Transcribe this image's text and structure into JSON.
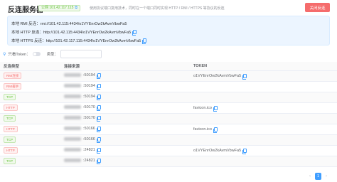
{
  "header": {
    "title": "反连服务器",
    "ip_badge": "公网 101.42.117.115",
    "description": "使用协议端口复用技术，同时在一个端口同时实现 HTTP / RMI / HTTPS 等协议的反连",
    "close_label": "关闭反连"
  },
  "info": {
    "rmi": "本地 RMI 反连：rmi://101.42.115:4434/o1VYEnrOw2kAvmVbwFa5",
    "http": "本地 HTTP 反连：http://101.42.115:4434/o1VYEnrOw2kAvmVbwFa5",
    "https": "本地 HTTPS 反连：http://101.42.117.115:4434/o1VYEnrOw2kAvmVbwFa5"
  },
  "filter": {
    "token_only_label": "只看Token：",
    "type_label": "类型："
  },
  "table": {
    "headers": [
      "反连类型",
      "连接来源",
      "TOKEN"
    ],
    "rows": [
      {
        "type": "RMI连接",
        "kind": "rmi",
        "port": ":50194",
        "token": "o1VYEnrOw2kAvmVbwFa5"
      },
      {
        "type": "RMI握手",
        "kind": "rmi",
        "port": ":50194",
        "token": ""
      },
      {
        "type": "TCP",
        "kind": "tcp",
        "port": ":50194",
        "token": ""
      },
      {
        "type": "HTTP",
        "kind": "http",
        "port": ":50170",
        "token": "favicon.ico"
      },
      {
        "type": "TCP",
        "kind": "tcp",
        "port": ":50170",
        "token": ""
      },
      {
        "type": "HTTP",
        "kind": "http",
        "port": ":50166",
        "token": "favicon.ico"
      },
      {
        "type": "TCP",
        "kind": "tcp",
        "port": ":50166",
        "token": ""
      },
      {
        "type": "HTTP",
        "kind": "http",
        "port": ":24821",
        "token": "o1VYEnrOw2kAvmVbwFa5"
      },
      {
        "type": "TCP",
        "kind": "tcp",
        "port": ":24821",
        "token": ""
      }
    ]
  },
  "pagination": {
    "prev": "‹",
    "current": "1",
    "next": "›"
  },
  "colors": {
    "accent": "#409eff",
    "danger": "#f56c6c",
    "success": "#67c23a"
  }
}
